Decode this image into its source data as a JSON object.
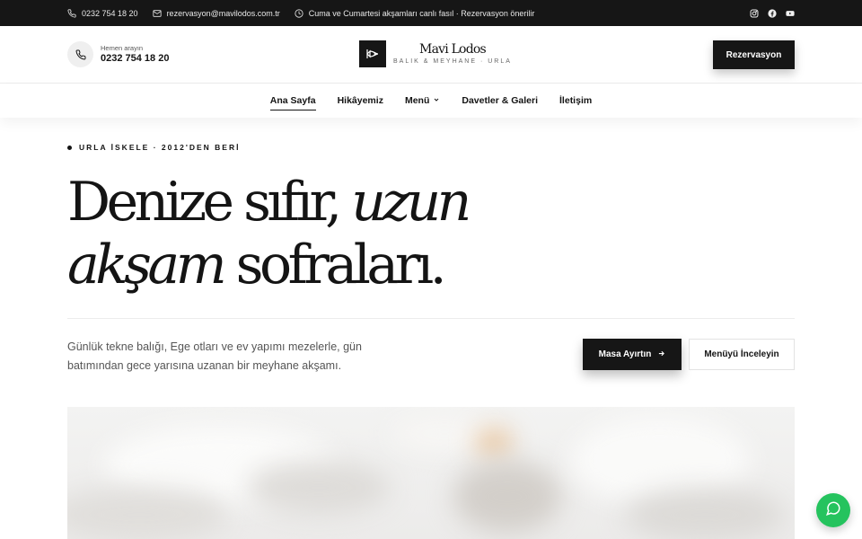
{
  "topbar": {
    "phone": "0232 754 18 20",
    "email": "rezervasyon@mavilodos.com.tr",
    "hours": "Cuma ve Cumartesi akşamları canlı fasıl · Rezervasyon önerilir",
    "social": [
      "instagram-icon",
      "facebook-icon",
      "youtube-icon"
    ]
  },
  "header": {
    "call_label": "Hemen arayın",
    "call_number": "0232 754 18 20",
    "brand_name": "Mavi Lodos",
    "brand_tagline": "BALIK & MEYHANE · URLA",
    "reserve_label": "Rezervasyon"
  },
  "nav": {
    "items": [
      {
        "label": "Ana Sayfa",
        "active": true
      },
      {
        "label": "Hikâyemiz"
      },
      {
        "label": "Menü",
        "dropdown": true
      },
      {
        "label": "Davetler & Galeri"
      },
      {
        "label": "İletişim"
      }
    ]
  },
  "hero": {
    "eyebrow": "URLA İSKELE · 2012'DEN BERİ",
    "headline_1": "Denize sıfır, ",
    "headline_1_em": "uzun",
    "headline_2_em": "akşam",
    "headline_2": " sofraları.",
    "lede": "Günlük tekne balığı, Ege otları ve ev yapımı mezelerle, gün batımından gece yarısına uzanan bir meyhane akşamı.",
    "cta_primary": "Masa Ayırtın",
    "cta_secondary": "Menüyü İnceleyin"
  },
  "colors": {
    "dark": "#161616",
    "text": "#141414",
    "muted": "#555555",
    "whatsapp": "#25c35e"
  }
}
